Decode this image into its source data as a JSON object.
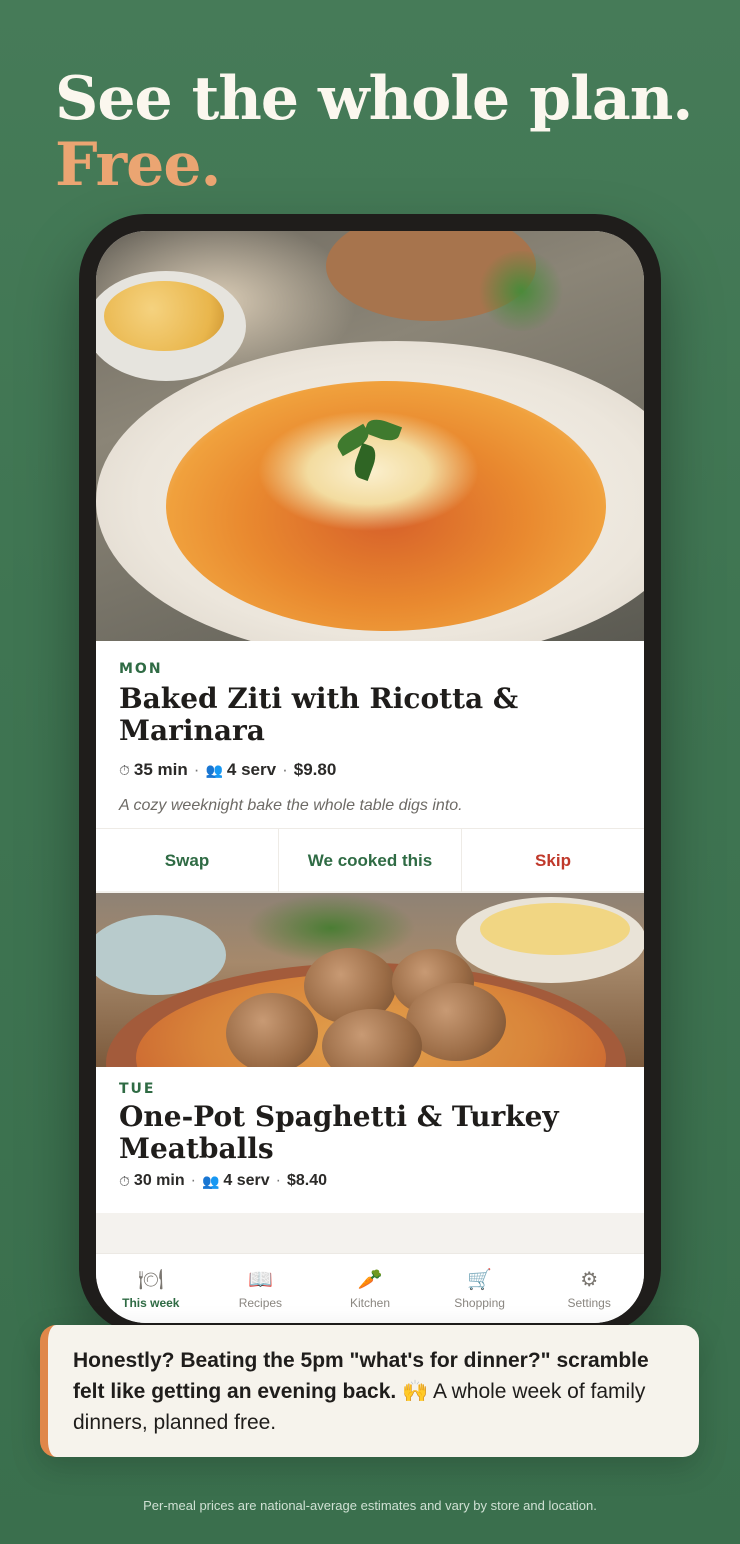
{
  "headline": {
    "line1": "See the whole plan.",
    "line2": "Free."
  },
  "meals": [
    {
      "day": "MON",
      "title": "Baked Ziti with Ricotta & Marinara",
      "time": "35 min",
      "servings": "4 serv",
      "price": "$9.80",
      "description": "A cozy weeknight bake the whole table digs into."
    },
    {
      "day": "TUE",
      "title": "One-Pot Spaghetti & Turkey Meatballs",
      "time": "30 min",
      "servings": "4 serv",
      "price": "$8.40"
    }
  ],
  "actions": {
    "swap": "Swap",
    "cooked": "We cooked this",
    "skip": "Skip"
  },
  "icons": {
    "clock": "⏱",
    "people": "👥",
    "separator": "·"
  },
  "tabs": [
    {
      "label": "This week",
      "icon": "🍽",
      "active": true
    },
    {
      "label": "Recipes",
      "icon": "📖",
      "active": false
    },
    {
      "label": "Kitchen",
      "icon": "🥕",
      "active": false
    },
    {
      "label": "Shopping",
      "icon": "🛒",
      "active": false
    },
    {
      "label": "Settings",
      "icon": "⚙",
      "active": false
    }
  ],
  "testimonial": {
    "bold": "Honestly? Beating the 5pm \"what's for dinner?\" scramble felt like getting an evening back.",
    "emoji": "🙌",
    "rest": "A whole week of family dinners, planned free."
  },
  "footnote": "Per-meal prices are national-average estimates and vary by store and location.",
  "colors": {
    "background": "#437856",
    "accent_orange": "#eba572",
    "brand_green": "#2f6b44",
    "skip_red": "#c0392b"
  }
}
